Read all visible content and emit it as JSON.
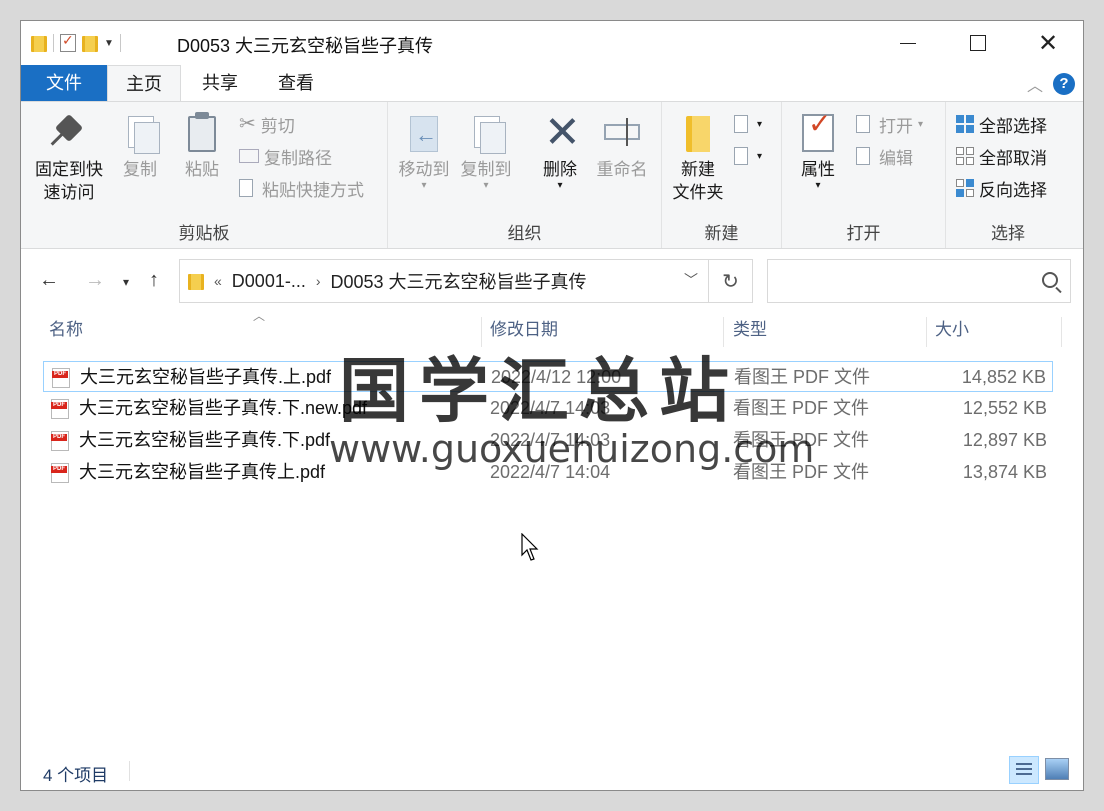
{
  "window": {
    "title": "D0053 大三元玄空秘旨些子真传"
  },
  "ribbon_tabs": {
    "file": "文件",
    "home": "主页",
    "share": "共享",
    "view": "查看"
  },
  "ribbon": {
    "clipboard": {
      "label": "剪贴板",
      "pin": "固定到快\n速访问",
      "pin_line1": "固定到快",
      "pin_line2": "速访问",
      "copy": "复制",
      "paste": "粘贴",
      "cut": "剪切",
      "copy_path": "复制路径",
      "paste_shortcut": "粘贴快捷方式"
    },
    "organize": {
      "label": "组织",
      "move_to": "移动到",
      "copy_to": "复制到",
      "delete": "删除",
      "rename": "重命名"
    },
    "new": {
      "label": "新建",
      "new_folder_line1": "新建",
      "new_folder_line2": "文件夹"
    },
    "open": {
      "label": "打开",
      "properties": "属性",
      "open": "打开",
      "edit": "编辑"
    },
    "select": {
      "label": "选择",
      "select_all": "全部选择",
      "select_none": "全部取消",
      "invert": "反向选择"
    }
  },
  "address": {
    "segments": [
      "D0001-...",
      "D0053 大三元玄空秘旨些子真传"
    ],
    "overflow": "«",
    "search_placeholder": ""
  },
  "columns": {
    "name": "名称",
    "date": "修改日期",
    "type": "类型",
    "size": "大小"
  },
  "files": [
    {
      "name": "大三元玄空秘旨些子真传.上.pdf",
      "date": "2022/4/12 12:00",
      "type": "看图王 PDF 文件",
      "size": "14,852 KB"
    },
    {
      "name": "大三元玄空秘旨些子真传.下.new.pdf",
      "date": "2022/4/7 14:03",
      "type": "看图王 PDF 文件",
      "size": "12,552 KB"
    },
    {
      "name": "大三元玄空秘旨些子真传.下.pdf",
      "date": "2022/4/7 14:03",
      "type": "看图王 PDF 文件",
      "size": "12,897 KB"
    },
    {
      "name": "大三元玄空秘旨些子真传上.pdf",
      "date": "2022/4/7 14:04",
      "type": "看图王 PDF 文件",
      "size": "13,874 KB"
    }
  ],
  "watermark": {
    "title": "国学汇总站",
    "url": "www.guoxuehuizong.com"
  },
  "status": {
    "count": "4 个项目"
  },
  "colors": {
    "accent": "#1a6fc4",
    "selection_border": "#99d1ff"
  }
}
